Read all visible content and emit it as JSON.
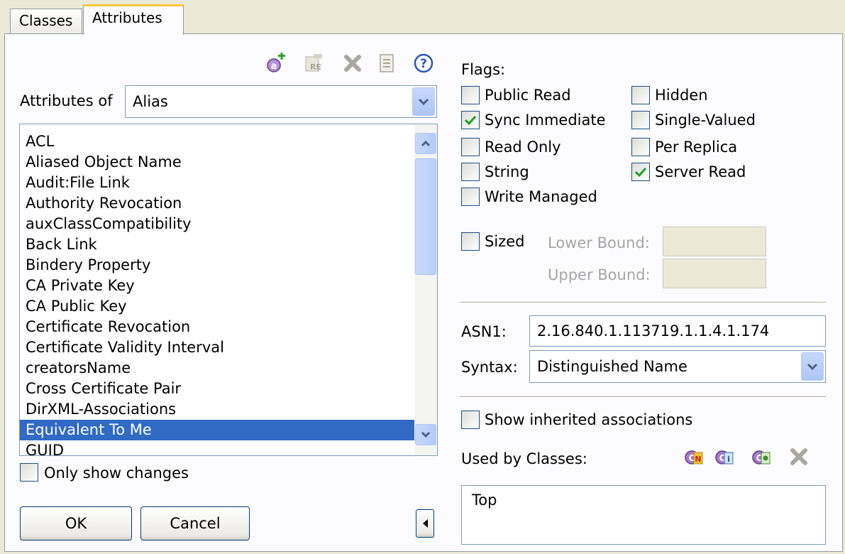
{
  "tabs": [
    {
      "label": "Classes",
      "active": false
    },
    {
      "label": "Attributes",
      "active": true
    }
  ],
  "toolbar": {
    "icons": [
      "add-attribute-icon",
      "rename-icon",
      "delete-icon",
      "properties-icon",
      "help-icon"
    ]
  },
  "attributes_of": {
    "label": "Attributes of",
    "value": "Alias"
  },
  "attribute_list": {
    "items": [
      "ACL",
      "Aliased Object Name",
      "Audit:File Link",
      "Authority Revocation",
      "auxClassCompatibility",
      "Back Link",
      "Bindery Property",
      "CA Private Key",
      "CA Public Key",
      "Certificate Revocation",
      "Certificate Validity Interval",
      "creatorsName",
      "Cross Certificate Pair",
      "DirXML-Associations",
      "Equivalent To Me",
      "GUID"
    ],
    "selected": "Equivalent To Me"
  },
  "only_show_changes": {
    "label": "Only show changes",
    "checked": false
  },
  "buttons": {
    "ok": "OK",
    "cancel": "Cancel"
  },
  "flags": {
    "title": "Flags:",
    "items": [
      {
        "label": "Public Read",
        "checked": false
      },
      {
        "label": "Sync Immediate",
        "checked": true
      },
      {
        "label": "Read Only",
        "checked": false
      },
      {
        "label": "String",
        "checked": false
      },
      {
        "label": "Write Managed",
        "checked": false
      },
      {
        "label": "Hidden",
        "checked": false
      },
      {
        "label": "Single-Valued",
        "checked": false
      },
      {
        "label": "Per Replica",
        "checked": false
      },
      {
        "label": "Server Read",
        "checked": true
      }
    ]
  },
  "sized": {
    "label": "Sized",
    "checked": false,
    "lower_bound_label": "Lower Bound:",
    "upper_bound_label": "Upper Bound:",
    "lower_bound_value": "",
    "upper_bound_value": ""
  },
  "asn1": {
    "label": "ASN1:",
    "value": "2.16.840.1.113719.1.1.4.1.174"
  },
  "syntax": {
    "label": "Syntax:",
    "value": "Distinguished Name"
  },
  "show_inherited": {
    "label": "Show inherited associations",
    "checked": false
  },
  "used_by": {
    "label": "Used by Classes:",
    "icons": [
      "new-class-icon",
      "class-info-icon",
      "class-settings-icon",
      "remove-class-icon"
    ],
    "items": [
      "Top"
    ]
  },
  "colors": {
    "selection": "#316ac5",
    "check_green": "#21a121",
    "tab_highlight": "#ffc83c"
  }
}
